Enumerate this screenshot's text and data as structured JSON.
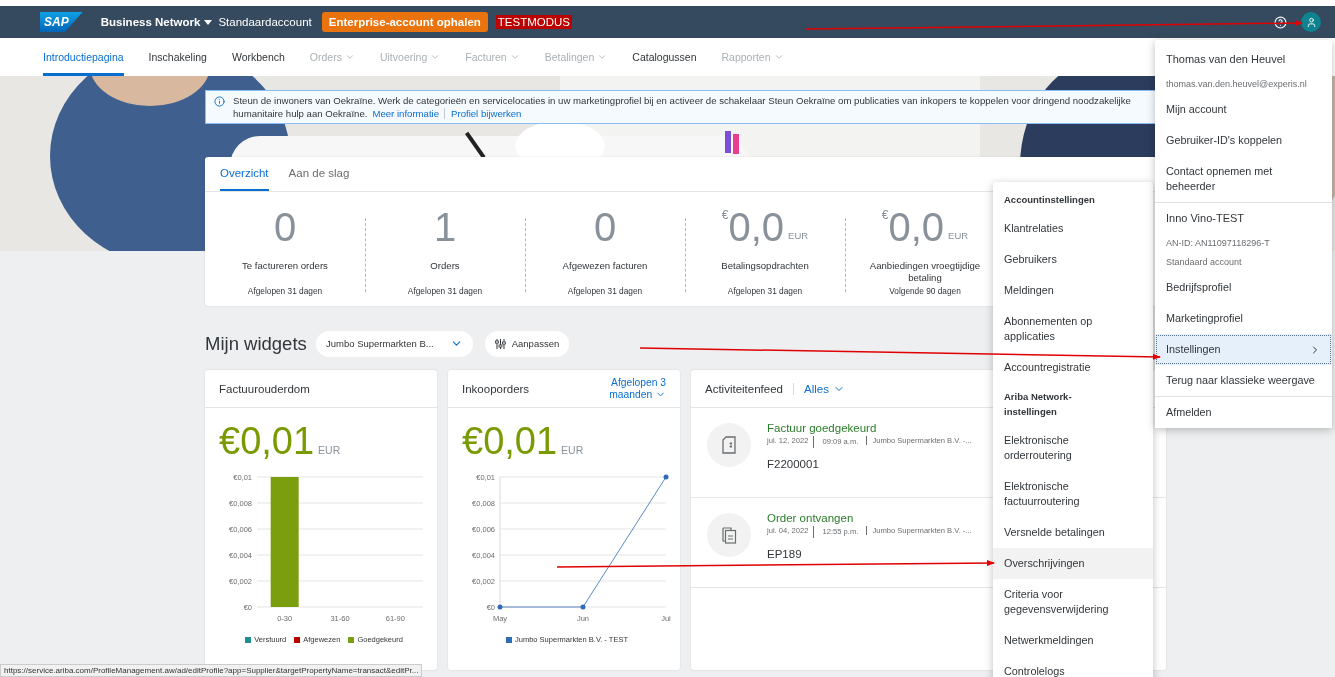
{
  "header": {
    "logo": "SAP",
    "product": "Business Network",
    "account": "Standaardaccount",
    "enterprise_button": "Enterprise-account ophalen",
    "mode_badge": "TESTMODUS"
  },
  "nav": [
    {
      "label": "Introductiepagina",
      "selected": true,
      "disabled": false,
      "dropdown": false
    },
    {
      "label": "Inschakeling",
      "selected": false,
      "disabled": false,
      "dropdown": false
    },
    {
      "label": "Workbench",
      "selected": false,
      "disabled": false,
      "dropdown": false
    },
    {
      "label": "Orders",
      "selected": false,
      "disabled": true,
      "dropdown": true
    },
    {
      "label": "Uitvoering",
      "selected": false,
      "disabled": true,
      "dropdown": true
    },
    {
      "label": "Facturen",
      "selected": false,
      "disabled": true,
      "dropdown": true
    },
    {
      "label": "Betalingen",
      "selected": false,
      "disabled": true,
      "dropdown": true
    },
    {
      "label": "Catalogussen",
      "selected": false,
      "disabled": false,
      "dropdown": false
    },
    {
      "label": "Rapporten",
      "selected": false,
      "disabled": true,
      "dropdown": true
    }
  ],
  "banner": {
    "text": "Steun de inwoners van Oekraïne. Werk de categorieën en servicelocaties in uw marketingprofiel bij en activeer de schakelaar Steun Oekraïne om publicaties van inkopers te koppelen voor dringend noodzakelijke humanitaire hulp aan Oekraïne.",
    "links": [
      "Meer informatie",
      "Profiel bijwerken"
    ]
  },
  "overview": {
    "tabs": [
      {
        "label": "Overzicht",
        "selected": true
      },
      {
        "label": "Aan de slag",
        "selected": false
      }
    ],
    "tiles": [
      {
        "value": "0",
        "label": "Te factureren orders",
        "period": "Afgelopen 31 dagen"
      },
      {
        "value": "1",
        "label": "Orders",
        "period": "Afgelopen 31 dagen"
      },
      {
        "value": "0",
        "label": "Afgewezen facturen",
        "period": "Afgelopen 31 dagen"
      },
      {
        "prefix": "€",
        "value": "0,0",
        "unit": "EUR",
        "label": "Betalingsopdrachten",
        "period": "Afgelopen 31 dagen"
      },
      {
        "prefix": "€",
        "value": "0,0",
        "unit": "EUR",
        "label": "Aanbiedingen vroegtijdige betaling",
        "period": "Volgende 90 dagen"
      }
    ]
  },
  "widgets": {
    "title": "Mijn widgets",
    "customer_select": "Jumbo Supermarkten B...",
    "customize_button": "Aanpassen"
  },
  "invoice_age": {
    "title": "Factuurouderdom",
    "amount": "€0,01",
    "unit": "EUR",
    "chart_data": {
      "type": "bar",
      "grid": true,
      "categories": [
        "0-30",
        "31-60",
        "61-90"
      ],
      "series": [
        {
          "name": "Verstuurd",
          "color": "#1b8f91",
          "values": [
            0,
            0,
            0
          ]
        },
        {
          "name": "Afgewezen",
          "color": "#bb0000",
          "values": [
            0,
            0,
            0
          ]
        },
        {
          "name": "Goedgekeurd",
          "color": "#7a9e0e",
          "values": [
            0.01,
            0,
            0
          ]
        }
      ],
      "ylim": [
        0,
        0.01
      ],
      "yticks": [
        {
          "value": 0,
          "label": "€0"
        },
        {
          "value": 0.002,
          "label": "€0,002"
        },
        {
          "value": 0.004,
          "label": "€0,004"
        },
        {
          "value": 0.006,
          "label": "€0,006"
        },
        {
          "value": 0.008,
          "label": "€0,008"
        },
        {
          "value": 0.01,
          "label": "€0,01"
        }
      ]
    }
  },
  "purchase_orders": {
    "title": "Inkooporders",
    "period": "Afgelopen 3 maanden",
    "amount": "€0,01",
    "unit": "EUR",
    "chart_data": {
      "type": "line",
      "grid": true,
      "categories": [
        "May",
        "Jun",
        "Jul"
      ],
      "series": [
        {
          "name": "Jumbo Supermarkten B.V. - TEST",
          "color": "#2f6cb5",
          "values": [
            0,
            0,
            0.01
          ]
        }
      ],
      "ylim": [
        0,
        0.01
      ],
      "yticks": [
        {
          "value": 0,
          "label": "€0"
        },
        {
          "value": 0.002,
          "label": "€0,002"
        },
        {
          "value": 0.004,
          "label": "€0,004"
        },
        {
          "value": 0.006,
          "label": "€0,006"
        },
        {
          "value": 0.008,
          "label": "€0,008"
        },
        {
          "value": 0.01,
          "label": "€0,01"
        }
      ]
    }
  },
  "activity_feed": {
    "title": "Activiteitenfeed",
    "filter": "Alles",
    "items": [
      {
        "kind": "invoice",
        "title": "Factuur goedgekeurd",
        "date": "jul. 12, 2022",
        "time": "09:09 a.m.",
        "org": "Jumbo Supermarkten B.V. -...",
        "id": "F2200001"
      },
      {
        "kind": "order",
        "title": "Order ontvangen",
        "date": "jul. 04, 2022",
        "time": "12:55 p.m.",
        "org": "Jumbo Supermarkten B.V. -...",
        "id": "EP189"
      }
    ]
  },
  "account_menu": {
    "sections": [
      {
        "items": [
          {
            "kind": "name",
            "label": "Thomas van den Heuvel",
            "selected": false
          },
          {
            "kind": "detail",
            "label": "thomas.van.den.heuvel@experis.nl",
            "selected": false
          },
          {
            "kind": "item",
            "label": "Mijn account",
            "selected": false
          },
          {
            "kind": "item",
            "label": "Gebruiker-ID's koppelen",
            "selected": false
          },
          {
            "kind": "item",
            "label": "Contact opnemen met beheerder",
            "selected": false
          }
        ]
      },
      {
        "items": [
          {
            "kind": "name",
            "label": "Inno Vino-TEST",
            "selected": false
          },
          {
            "kind": "detail",
            "label": "AN-ID: AN11097118296-T",
            "selected": false
          },
          {
            "kind": "detail",
            "label": "Standaard account",
            "selected": false
          },
          {
            "kind": "item",
            "label": "Bedrijfsprofiel",
            "selected": false
          },
          {
            "kind": "item",
            "label": "Marketingprofiel",
            "selected": false
          },
          {
            "kind": "submenu",
            "label": "Instellingen",
            "selected": true
          },
          {
            "kind": "item",
            "label": "Terug naar klassieke weergave",
            "selected": false
          }
        ]
      },
      {
        "items": [
          {
            "kind": "item",
            "label": "Afmelden",
            "selected": false
          }
        ]
      }
    ]
  },
  "settings_menu": {
    "items": [
      {
        "kind": "header",
        "label": "Accountinstellingen",
        "selected": false
      },
      {
        "kind": "item",
        "label": "Klantrelaties",
        "selected": false
      },
      {
        "kind": "item",
        "label": "Gebruikers",
        "selected": false
      },
      {
        "kind": "item",
        "label": "Meldingen",
        "selected": false
      },
      {
        "kind": "item",
        "label": "Abonnementen op applicaties",
        "selected": false
      },
      {
        "kind": "item",
        "label": "Accountregistratie",
        "selected": false
      },
      {
        "kind": "header",
        "label": "Ariba Network-instellingen",
        "selected": false
      },
      {
        "kind": "item",
        "label": "Elektronische orderroutering",
        "selected": false
      },
      {
        "kind": "item",
        "label": "Elektronische factuurroutering",
        "selected": false
      },
      {
        "kind": "item",
        "label": "Versnelde betalingen",
        "selected": false
      },
      {
        "kind": "item",
        "label": "Overschrijvingen",
        "selected": true
      },
      {
        "kind": "item",
        "label": "Criteria voor gegevensverwijdering",
        "selected": false
      },
      {
        "kind": "item",
        "label": "Netwerkmeldingen",
        "selected": false
      },
      {
        "kind": "item",
        "label": "Controlelogs",
        "selected": false
      }
    ]
  },
  "status_url": "https://service.ariba.com/ProfileManagement.aw/ad/editProfile?app=Supplier&targetPropertyName=transact&editPr..."
}
